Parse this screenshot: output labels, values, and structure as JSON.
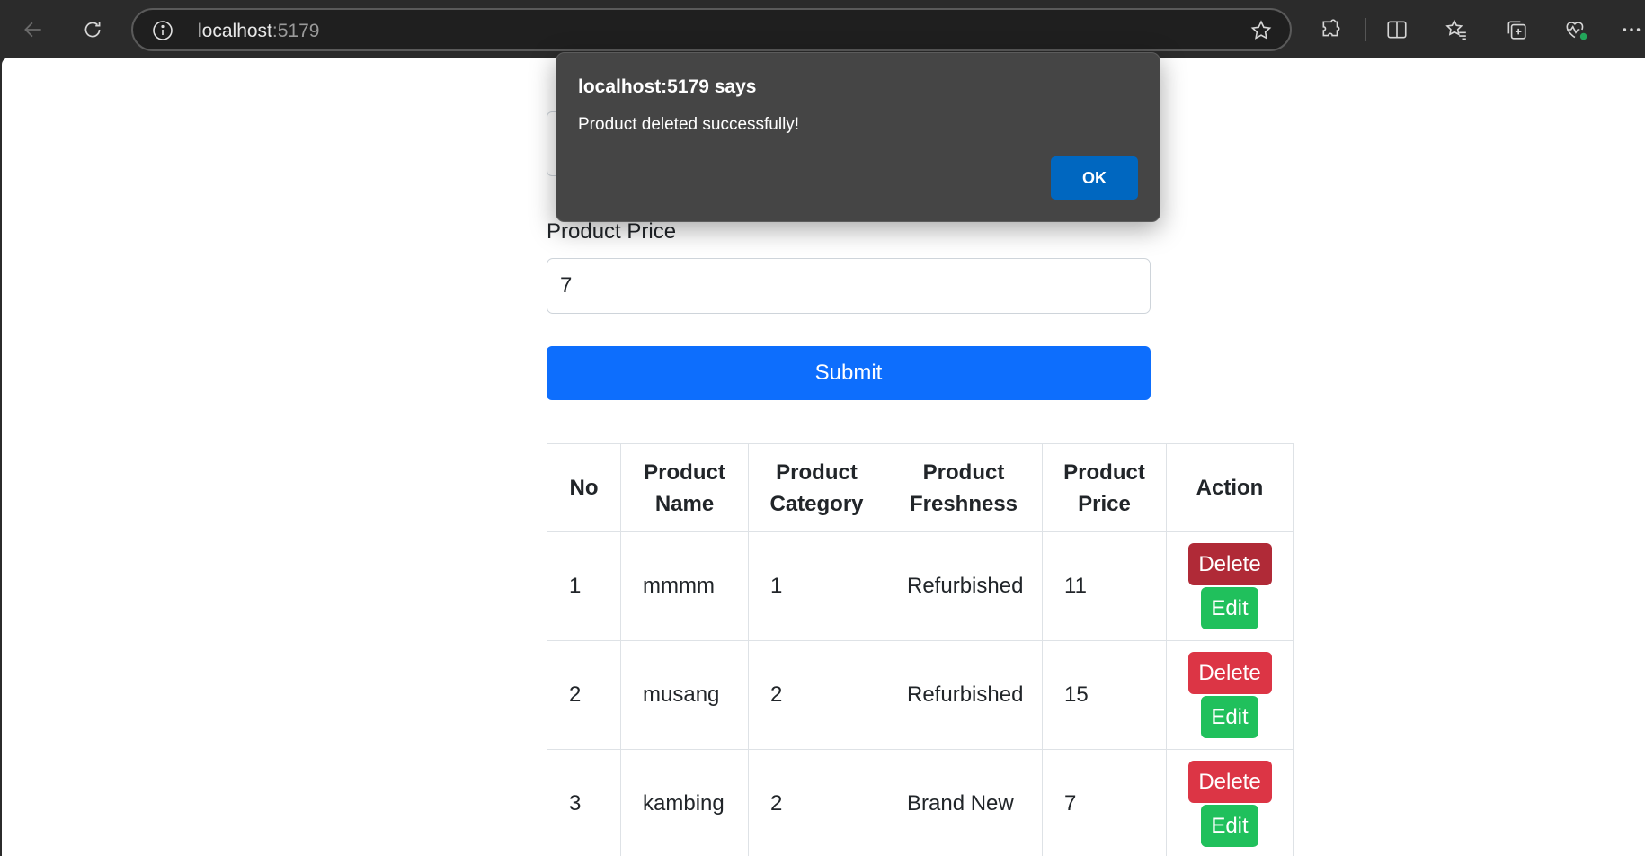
{
  "browser": {
    "url_host": "localhost",
    "url_port": ":5179",
    "icons": [
      "back-icon",
      "refresh-icon",
      "info-icon",
      "favorite-star-icon",
      "extensions-icon",
      "split-screen-icon",
      "favorites-icon",
      "collections-icon",
      "browser-essentials-icon",
      "more-icon"
    ]
  },
  "form": {
    "price_label": "Product Price",
    "price_value": "7",
    "submit_label": "Submit"
  },
  "table": {
    "headers": [
      {
        "line1": "No",
        "line2": ""
      },
      {
        "line1": "Product",
        "line2": "Name"
      },
      {
        "line1": "Product",
        "line2": "Category"
      },
      {
        "line1": "Product",
        "line2": "Freshness"
      },
      {
        "line1": "Product",
        "line2": "Price"
      },
      {
        "line1": "Action",
        "line2": ""
      }
    ],
    "rows": [
      {
        "no": "1",
        "name": "mmmm",
        "category": "1",
        "freshness": "Refurbished",
        "price": "11",
        "delete": "Delete",
        "edit": "Edit"
      },
      {
        "no": "2",
        "name": "musang",
        "category": "2",
        "freshness": "Refurbished",
        "price": "15",
        "delete": "Delete",
        "edit": "Edit"
      },
      {
        "no": "3",
        "name": "kambing",
        "category": "2",
        "freshness": "Brand New",
        "price": "7",
        "delete": "Delete",
        "edit": "Edit"
      }
    ]
  },
  "dialog": {
    "title": "localhost:5179 says",
    "message": "Product deleted successfully!",
    "ok_label": "OK"
  },
  "colors": {
    "primary": "#0d6efd",
    "danger": "#dc3545",
    "danger_pressed": "#b02a37",
    "success": "#20c05c",
    "dialog_bg": "#454545",
    "dialog_ok": "#0067c0"
  }
}
